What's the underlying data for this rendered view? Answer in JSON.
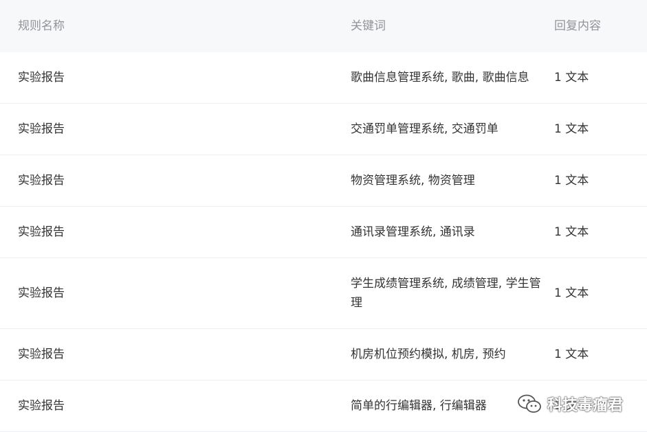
{
  "table": {
    "headers": {
      "rule_name": "规则名称",
      "keywords": "关键词",
      "reply_content": "回复内容"
    },
    "rows": [
      {
        "rule_name": "实验报告",
        "keywords": "歌曲信息管理系统, 歌曲, 歌曲信息",
        "reply": "1 文本"
      },
      {
        "rule_name": "实验报告",
        "keywords": "交通罚单管理系统, 交通罚单",
        "reply": "1 文本"
      },
      {
        "rule_name": "实验报告",
        "keywords": "物资管理系统, 物资管理",
        "reply": "1 文本"
      },
      {
        "rule_name": "实验报告",
        "keywords": "通讯录管理系统, 通讯录",
        "reply": "1 文本"
      },
      {
        "rule_name": "实验报告",
        "keywords": "学生成绩管理系统, 成绩管理, 学生管理",
        "reply": "1 文本"
      },
      {
        "rule_name": "实验报告",
        "keywords": "机房机位预约模拟, 机房, 预约",
        "reply": "1 文本"
      },
      {
        "rule_name": "实验报告",
        "keywords": "简单的行编辑器, 行编辑器",
        "reply": "1 文本"
      }
    ]
  },
  "watermark": {
    "text": "科技毒瘤君",
    "icon": "wechat-icon"
  }
}
